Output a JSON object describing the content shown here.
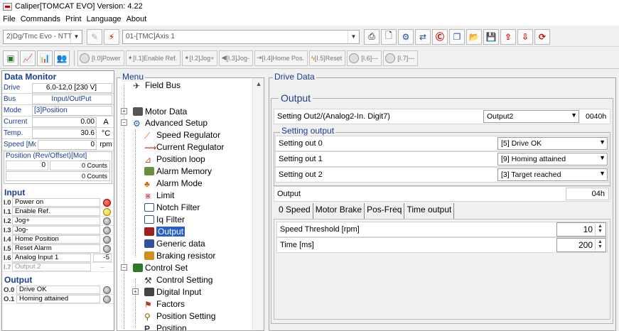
{
  "window": {
    "title": "Caliper[TOMCAT EVO] Version: 4.22"
  },
  "menubar": [
    "File",
    "Commands",
    "Print",
    "Language",
    "About"
  ],
  "toolbar": {
    "device_combo": "2)Dg/Tmc Evo - NTT",
    "axis_combo": "01-[TMC]Axis 1",
    "jog_buttons": [
      "[I.0]Power",
      "[I.1]Enable Ref.",
      "[I.2]Jog+",
      "[I.3]Jog-",
      "[I.4]Home Pos.",
      "[I.5]Reset",
      "[I.6]---",
      "[I.7]---"
    ]
  },
  "monitor": {
    "title": "Data Monitor",
    "rows": [
      {
        "label": "Drive",
        "value": "6,0-12,0 [230 V]",
        "unit": ""
      },
      {
        "label": "Bus",
        "value": "Input/OutPut",
        "unit": ""
      },
      {
        "label": "Mode",
        "value": "[3]Position",
        "unit": ""
      },
      {
        "label": "Current",
        "value": "0.00",
        "unit": "A"
      },
      {
        "label": "Temp.",
        "value": "30.6",
        "unit": "°C"
      },
      {
        "label": "Speed [Mot",
        "value": "0",
        "unit": "rpm"
      }
    ],
    "position_caption": "Position (Rev/Offset)[Mot]",
    "position_rev": "0",
    "position_counts1": "0 Counts",
    "position_counts2": "0 Counts",
    "input_title": "Input",
    "inputs": [
      {
        "key": "I.0",
        "label": "Power on",
        "state": "red"
      },
      {
        "key": "I.1",
        "label": "Enable Ref.",
        "state": "yellow"
      },
      {
        "key": "I.2",
        "label": "Jog+",
        "state": "gray"
      },
      {
        "key": "I.3",
        "label": "Jog-",
        "state": "gray"
      },
      {
        "key": "I.4",
        "label": "Home Position",
        "state": "gray"
      },
      {
        "key": "I.5",
        "label": "Reset Alarm",
        "state": "gray"
      }
    ],
    "analog1": {
      "key": "I.6",
      "label": "Analog Input 1",
      "value": "-5"
    },
    "output2_in": {
      "key": "I.7",
      "label": "Output 2",
      "value": "--"
    },
    "output_title": "Output",
    "outputs": [
      {
        "key": "O.0",
        "label": "Drive OK",
        "state": "gray"
      },
      {
        "key": "O.1",
        "label": "Homing attained",
        "state": "gray"
      }
    ]
  },
  "menu": {
    "caption": "Menu",
    "items": [
      "Field Bus",
      "Motor Data",
      "Advanced Setup",
      "Speed Regulator",
      "Current Regulator",
      "Position loop",
      "Alarm Memory",
      "Alarm Mode",
      "Limit",
      "Notch Filter",
      "Iq Filter",
      "Output",
      "Generic data",
      "Braking resistor",
      "Control Set",
      "Control Setting",
      "Digital Input",
      "Factors",
      "Position Setting",
      "Position"
    ]
  },
  "drive": {
    "caption": "Drive Data",
    "output_caption": "Output",
    "setting_label": "Setting Out2/(Analog2-In. Digit7)",
    "setting_combo": "Output2",
    "setting_hex": "0040h",
    "setting_output_caption": "Setting output",
    "settings": [
      {
        "label": "Setting out 0",
        "value": "[5] Drive OK"
      },
      {
        "label": "Setting out 1",
        "value": "[9] Homing attained"
      },
      {
        "label": "Setting out 2",
        "value": "[3] Target reached"
      }
    ],
    "output_label": "Output",
    "output_value": "04h",
    "tabs": [
      "0 Speed",
      "Motor Brake",
      "Pos-Freq",
      "Time output"
    ],
    "speed_label": "Speed Threshold [rpm]",
    "speed_value": "10",
    "time_label": "Time [ms]",
    "time_value": "200"
  }
}
